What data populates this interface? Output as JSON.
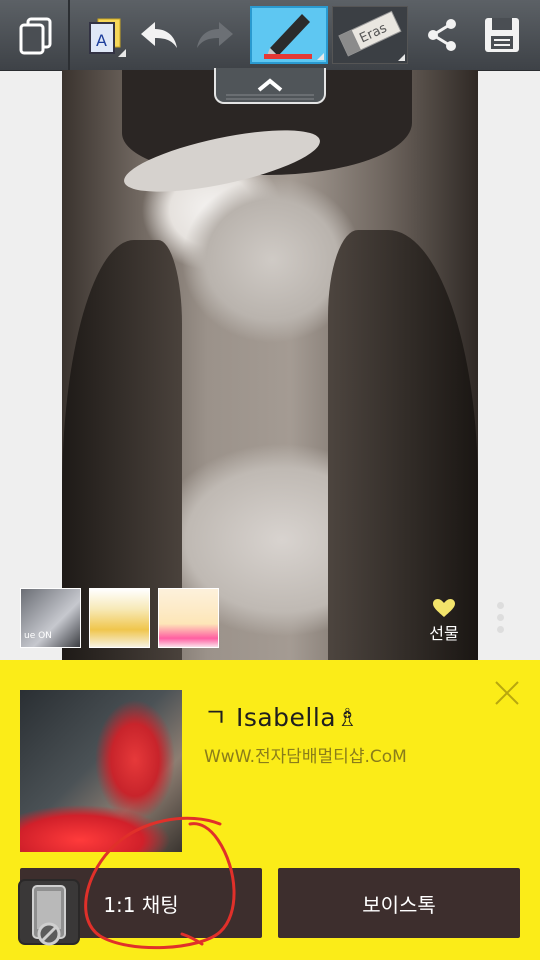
{
  "toolbar": {
    "tools": [
      {
        "icon": "copy-pages-icon"
      },
      {
        "icon": "text-background-icon"
      },
      {
        "icon": "undo-icon"
      },
      {
        "icon": "redo-icon"
      },
      {
        "icon": "pen-icon",
        "active": true
      },
      {
        "icon": "eraser-icon",
        "label": "Eras"
      },
      {
        "icon": "share-icon"
      },
      {
        "icon": "save-icon"
      }
    ],
    "pen_color": "#e53935",
    "pull_tab_icon": "chevron-up-icon"
  },
  "photo": {
    "thumbnails": [
      {
        "icon": "photo-thumbnail",
        "overlay_text": "ue ON"
      },
      {
        "icon": "product-thumbnail"
      },
      {
        "icon": "sticker-thumbnail"
      }
    ],
    "gift_label": "선물",
    "gift_icon": "heart-gift-icon",
    "more_icon": "more-vertical-icon"
  },
  "profile": {
    "name": "ㄱ Isabella♗",
    "status_message": "WwW.전자담배멀티샵.CoM",
    "close_icon": "close-icon",
    "chat_button": "1:1 채팅",
    "voice_button": "보이스톡",
    "phone_badge_icon": "no-phone-icon",
    "panel_color": "#fbec18",
    "button_color": "#3d2e2d"
  }
}
